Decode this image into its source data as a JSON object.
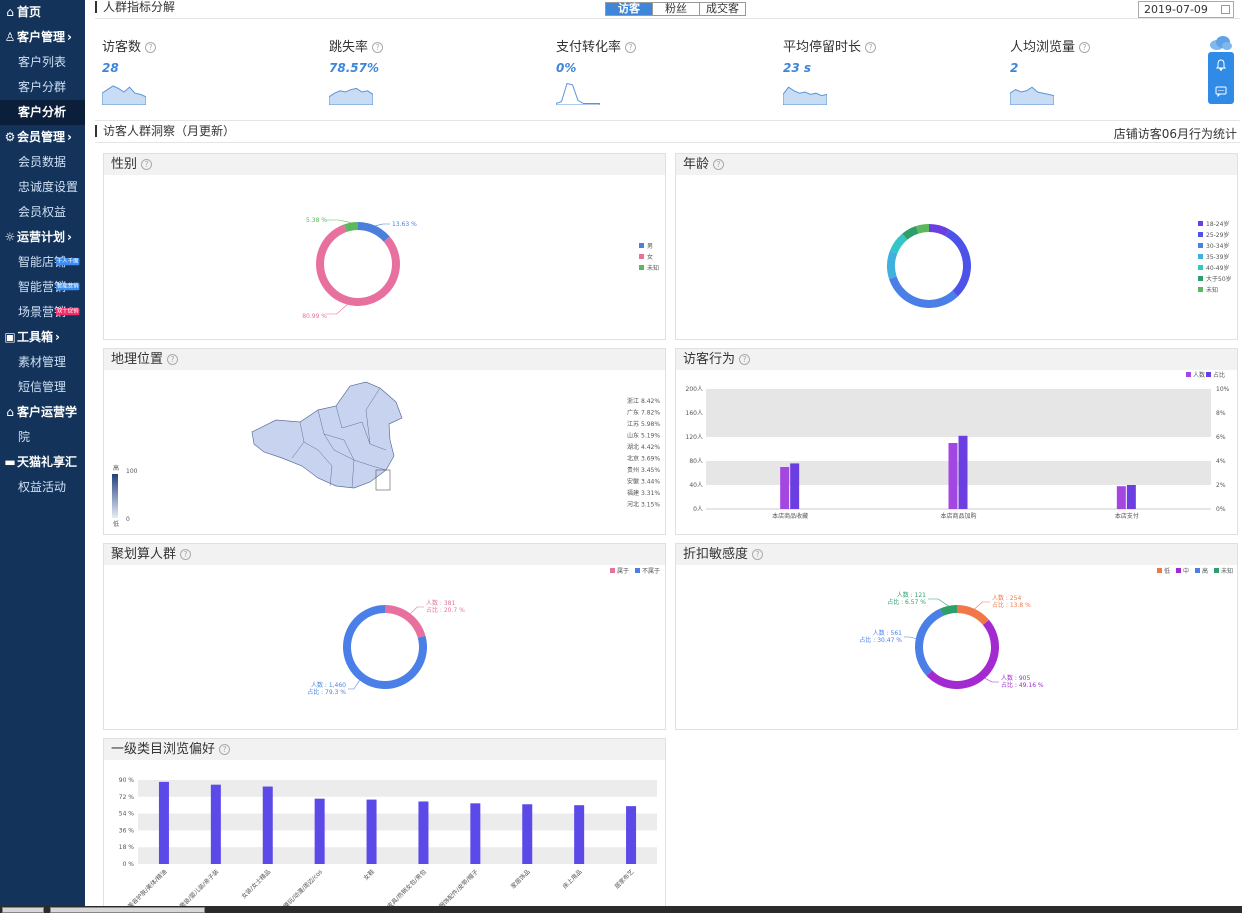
{
  "sidebar": {
    "items": [
      {
        "label": "首页",
        "type": "top",
        "icon": "home-icon",
        "glyph": "⌂",
        "arrow": ""
      },
      {
        "label": "客户管理",
        "type": "top",
        "icon": "customer-icon",
        "glyph": "♙",
        "arrow": "›"
      },
      {
        "label": "客户列表",
        "type": "sub"
      },
      {
        "label": "客户分群",
        "type": "sub"
      },
      {
        "label": "客户分析",
        "type": "sub",
        "active": true
      },
      {
        "label": "会员管理",
        "type": "top",
        "icon": "member-icon",
        "glyph": "⚙",
        "arrow": "›"
      },
      {
        "label": "会员数据",
        "type": "sub"
      },
      {
        "label": "忠诚度设置",
        "type": "sub"
      },
      {
        "label": "会员权益",
        "type": "sub"
      },
      {
        "label": "运营计划",
        "type": "top",
        "icon": "bulb-icon",
        "glyph": "☼",
        "arrow": "›"
      },
      {
        "label": "智能店铺",
        "type": "sub",
        "tag": "千人千面",
        "tagColor": "blue"
      },
      {
        "label": "智能营销",
        "type": "sub",
        "tag": "智能营销",
        "tagColor": "blue"
      },
      {
        "label": "场景营销",
        "type": "sub",
        "tag": "双十促销",
        "tagColor": "red"
      },
      {
        "label": "工具箱",
        "type": "top",
        "icon": "toolbox-icon",
        "glyph": "▣",
        "arrow": "›"
      },
      {
        "label": "素材管理",
        "type": "sub"
      },
      {
        "label": "短信管理",
        "type": "sub"
      },
      {
        "label": "客户运营学",
        "type": "top",
        "icon": "school-icon",
        "glyph": "⌂",
        "arrow": ""
      },
      {
        "label": "院",
        "type": "sub"
      },
      {
        "label": "天猫礼享汇",
        "type": "top",
        "icon": "gift-icon",
        "glyph": "▬",
        "arrow": ""
      },
      {
        "label": "权益活动",
        "type": "sub"
      }
    ]
  },
  "header": {
    "section1_title": "人群指标分解",
    "tabs": [
      {
        "label": "访客",
        "active": true
      },
      {
        "label": "粉丝",
        "active": false
      },
      {
        "label": "成交客",
        "active": false
      }
    ],
    "date": "2019-07-09"
  },
  "metrics": [
    {
      "name": "访客数",
      "value": "28"
    },
    {
      "name": "跳失率",
      "value": "78.57%"
    },
    {
      "name": "支付转化率",
      "value": "0%"
    },
    {
      "name": "平均停留时长",
      "value": "23 s"
    },
    {
      "name": "人均浏览量",
      "value": "2"
    }
  ],
  "section2": {
    "title": "访客人群洞察（月更新）",
    "note": "店铺访客06月行为统计"
  },
  "panels": {
    "gender": "性别",
    "age": "年龄",
    "geo": "地理位置",
    "behavior": "访客行为",
    "juhuasuan": "聚划算人群",
    "discount": "折扣敏感度",
    "category": "一级类目浏览偏好"
  },
  "chart_data": [
    {
      "id": "gender",
      "type": "pie",
      "title": "性别",
      "slices": [
        {
          "name": "男",
          "value": 13.63,
          "label": "13.63 %",
          "color": "#4a7fdc"
        },
        {
          "name": "女",
          "value": 80.99,
          "label": "80.99 %",
          "color": "#e8709f"
        },
        {
          "name": "未知",
          "value": 5.38,
          "label": "5.38 %",
          "color": "#5cb85c"
        }
      ],
      "legend": "right"
    },
    {
      "id": "age",
      "type": "pie",
      "title": "年龄",
      "slices": [
        {
          "name": "18-24岁",
          "value": 8,
          "color": "#6a3ee0"
        },
        {
          "name": "25-29岁",
          "value": 30,
          "color": "#4d52e8"
        },
        {
          "name": "30-34岁",
          "value": 32,
          "color": "#4a7fe8"
        },
        {
          "name": "35-39岁",
          "value": 11,
          "color": "#3fb0e0"
        },
        {
          "name": "40-49岁",
          "value": 8,
          "color": "#33c6c6"
        },
        {
          "name": "大于50岁",
          "value": 6,
          "color": "#2e9f6a"
        },
        {
          "name": "未知",
          "value": 5,
          "color": "#5cb85c"
        }
      ],
      "legend": "right"
    },
    {
      "id": "geo",
      "type": "table",
      "title": "地理位置",
      "rows": [
        {
          "name": "浙江",
          "value": "8.42%"
        },
        {
          "name": "广东",
          "value": "7.82%"
        },
        {
          "name": "江苏",
          "value": "5.98%"
        },
        {
          "name": "山东",
          "value": "5.19%"
        },
        {
          "name": "湖北",
          "value": "4.42%"
        },
        {
          "name": "北京",
          "value": "3.69%"
        },
        {
          "name": "贵州",
          "value": "3.45%"
        },
        {
          "name": "安徽",
          "value": "3.44%"
        },
        {
          "name": "福建",
          "value": "3.31%"
        },
        {
          "name": "河北",
          "value": "3.15%"
        }
      ],
      "scale": {
        "high": "高",
        "low": "低",
        "max": "100",
        "min": "0"
      }
    },
    {
      "id": "behavior",
      "type": "bar",
      "title": "访客行为",
      "categories": [
        "本店商品收藏",
        "本店商品加购",
        "本店支付"
      ],
      "series": [
        {
          "name": "人数",
          "values": [
            70,
            110,
            38
          ],
          "color": "#a347e0"
        },
        {
          "name": "占比",
          "values": [
            3.8,
            6.1,
            2.0
          ],
          "color": "#6a3ee0"
        }
      ],
      "yLeftTicks": [
        "0人",
        "40人",
        "80人",
        "120人",
        "160人",
        "200人"
      ],
      "yRightTicks": [
        "0%",
        "2%",
        "4%",
        "6%",
        "8%",
        "10%"
      ],
      "ylim": [
        0,
        200
      ],
      "ylim_right": [
        0,
        10
      ],
      "legend": "top-right"
    },
    {
      "id": "juhuasuan",
      "type": "pie",
      "title": "聚划算人群",
      "slices": [
        {
          "name": "属于",
          "value": 381,
          "label1": "人数 : 381",
          "label2": "占比 : 20.7 %",
          "color": "#e8709f"
        },
        {
          "name": "不属于",
          "value": 1460,
          "label1": "人数 : 1,460",
          "label2": "占比 : 79.3 %",
          "color": "#4a7fe8"
        }
      ],
      "legend": "top-right"
    },
    {
      "id": "discount",
      "type": "pie",
      "title": "折扣敏感度",
      "slices": [
        {
          "name": "低",
          "value": 254,
          "label1": "人数 : 254",
          "label2": "占比 : 13.8 %",
          "color": "#f07848"
        },
        {
          "name": "中",
          "value": 905,
          "label1": "人数 : 905",
          "label2": "占比 : 49.16 %",
          "color": "#a32ad0"
        },
        {
          "name": "高",
          "value": 561,
          "label1": "人数 : 561",
          "label2": "占比 : 30.47 %",
          "color": "#4a7fe8"
        },
        {
          "name": "未知",
          "value": 121,
          "label1": "人数 : 121",
          "label2": "占比 : 6.57 %",
          "color": "#2e9f6a"
        }
      ],
      "legend": "top-right"
    },
    {
      "id": "category",
      "type": "bar",
      "title": "一级类目浏览偏好",
      "categories": [
        "美容护肤/美体/精油",
        "童装/婴儿装/亲子装",
        "女装/女士精品",
        "模玩/动漫/周边/cos",
        "女鞋",
        "箱包皮具/热销女包/男包",
        "服饰配件/皮带/帽子",
        "家居饰品",
        "床上用品",
        "居家布艺"
      ],
      "values": [
        88,
        85,
        83,
        70,
        69,
        67,
        65,
        64,
        63,
        62
      ],
      "yTicks": [
        "0 %",
        "18 %",
        "36 %",
        "54 %",
        "72 %",
        "90 %"
      ],
      "ylim": [
        0,
        90
      ],
      "color": "#5b4ae8"
    }
  ]
}
